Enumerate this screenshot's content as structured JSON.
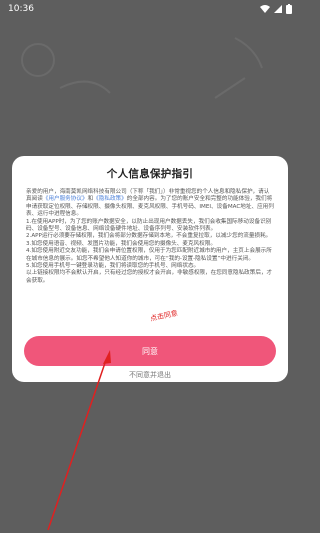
{
  "status_bar": {
    "time": "10:36"
  },
  "dialog": {
    "title": "个人信息保护指引",
    "greeting": "亲爱的用户，海南莫凯网络科技有限公司（下称「我们」）非常重视您的个人信息和隐私保护，请认真阅读",
    "link_service": "《用户服务协议》",
    "conj": "和",
    "link_privacy": "《隐私政策》",
    "greeting_tail": "的全部内容。为了您的账户安全和完整的功能体验，我们将申请获取定位权限、存储权限、摄像头权限、麦克风权限、手机号码、IMEI、设备MAC地址、应用列表、运行中进程信息。",
    "item1": "1.在使用APP时，为了您的账户数据安全，以防止出现用户数据丢失，我们会收集国际移动设备识别码、设备型号、设备信息、网络设备硬件地址、设备序列号、安装软件列表。",
    "item2": "2.APP运行必须要存储权限，我们会将部分数据存储到本地，不会重复拉取，以减少您的流量损耗。",
    "item3": "3.如您使用语音、视频、发图片功能，我们会使用您的摄像头、麦克风权限。",
    "item4": "4.如您使用附近交友功能，我们会申请位置权限，仅用于为您匹配附近城市的用户，主页上会展示所在城市信息的展示。如您不希望他人知道你的城市，可在“我的-设置-隐私设置”中进行关闭。",
    "item5": "5.如您使用手机号一键登录功能，我们将读取您的手机号、网络状态。",
    "footer": "以上链接权限均不会默认开启，只有经过您的授权才会开启，非敏感权限，在您同意隐私政策后，才会获取。",
    "agree_label": "同意",
    "disagree_label": "不同意并退出"
  },
  "annotation": {
    "text": "点击同意"
  },
  "colors": {
    "accent": "#f0567a",
    "link": "#4a7fd9",
    "annotation": "#e02020"
  },
  "icons": [
    "wifi-icon",
    "signal-icon",
    "battery-icon"
  ]
}
